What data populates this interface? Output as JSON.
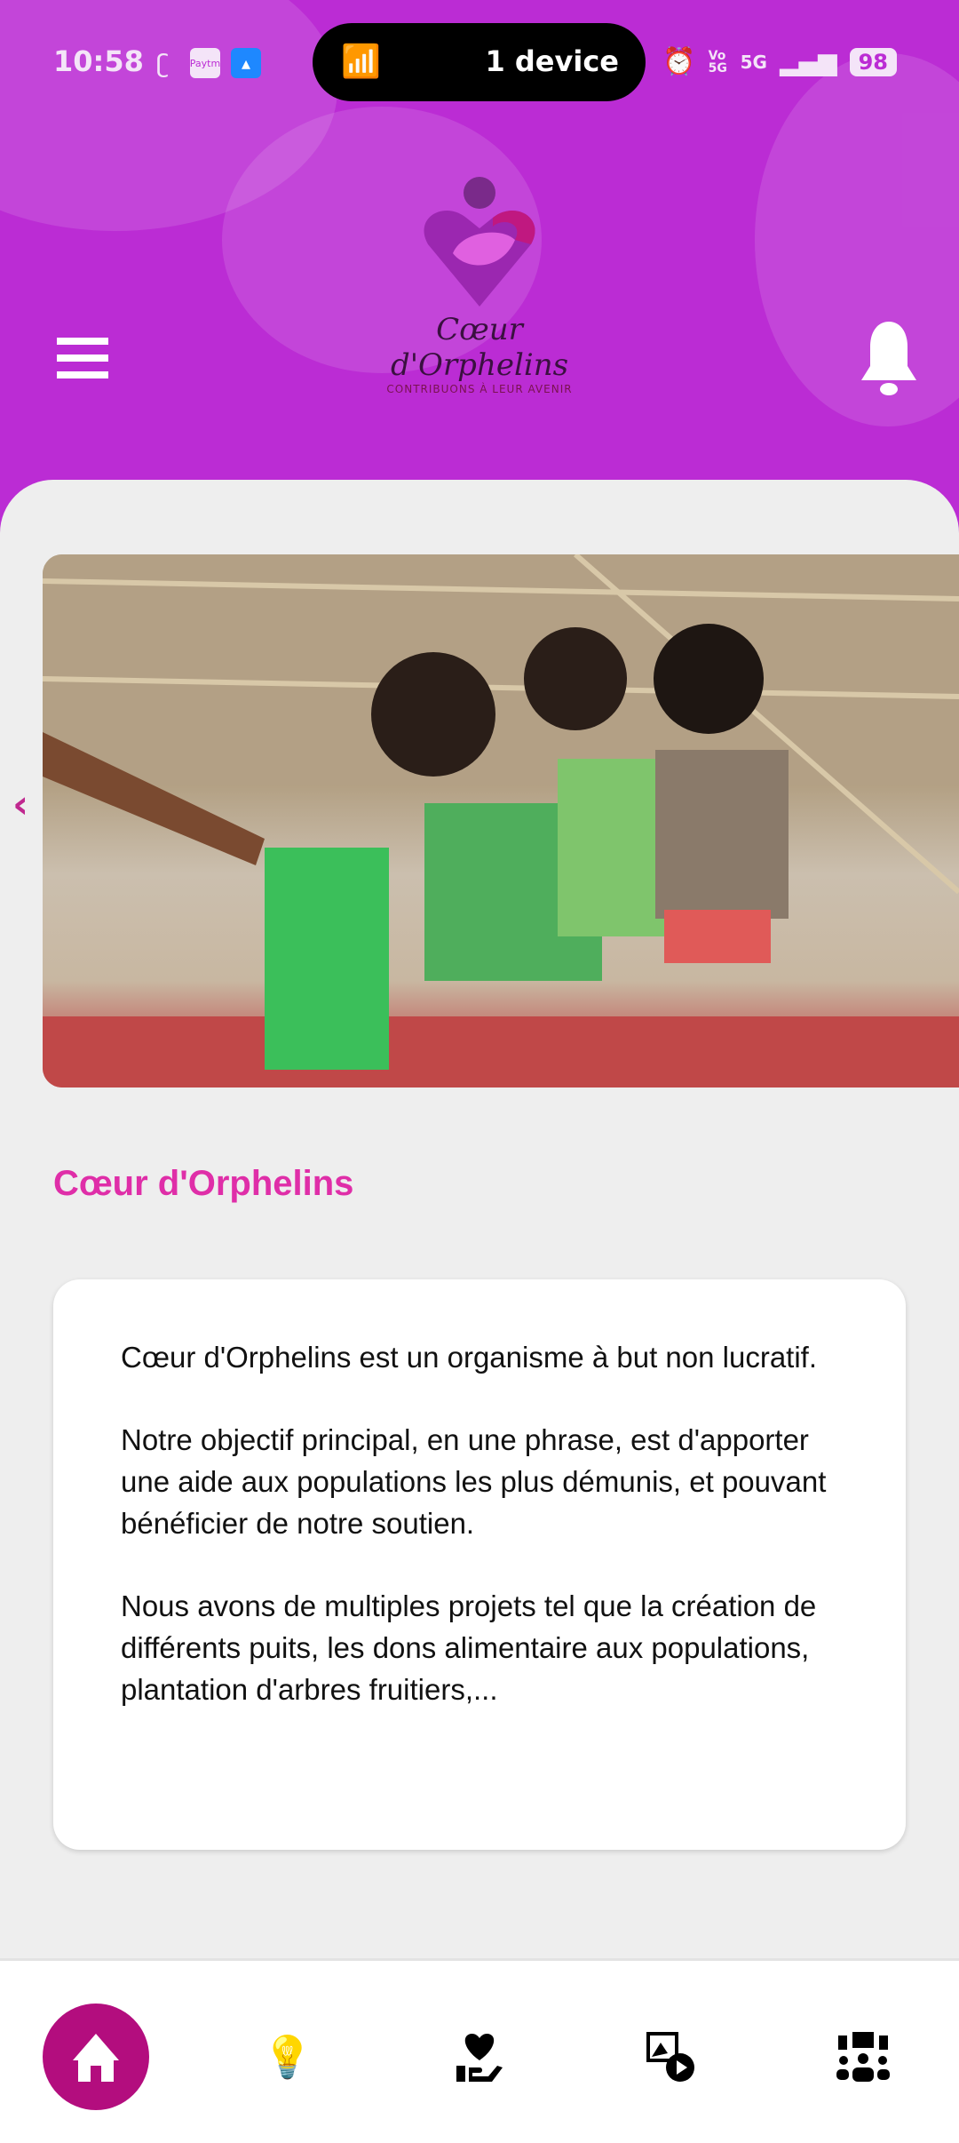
{
  "status_bar": {
    "time": "10:58",
    "paytm": "Paytm",
    "hotspot_text": "1 device",
    "network": "Vo 5G",
    "signal": "5G",
    "battery": "98"
  },
  "header": {
    "logo_name": "Cœur d'Orphelins",
    "logo_tagline": "CONTRIBUONS À LEUR AVENIR"
  },
  "main": {
    "title": "Cœur d'Orphelins",
    "paragraphs": [
      "Cœur d'Orphelins est un organisme à but non lucratif.",
      "Notre objectif principal, en une phrase, est d'apporter une aide aux populations les plus démunis, et pouvant bénéficier de notre soutien.",
      "Nous avons de multiples projets tel que la création de différents puits, les dons alimentaire aux populations, plantation d'arbres fruitiers,..."
    ]
  },
  "nav": {
    "items": [
      {
        "icon": "home-icon",
        "active": true
      },
      {
        "icon": "lightbulb-gear-icon"
      },
      {
        "icon": "heart-hand-icon"
      },
      {
        "icon": "image-video-icon"
      },
      {
        "icon": "community-icon"
      }
    ]
  },
  "colors": {
    "header": "#bb2cd4",
    "accent": "#b30d7e",
    "title": "#df2ea8"
  }
}
